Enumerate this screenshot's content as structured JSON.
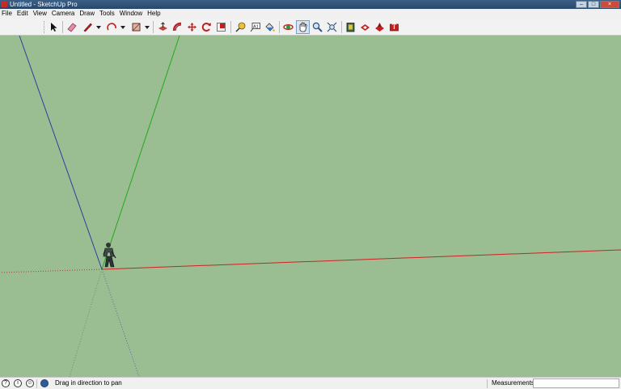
{
  "window": {
    "title": "Untitled - SketchUp Pro",
    "controls": [
      "minimize",
      "maximize",
      "close"
    ]
  },
  "menu": [
    "File",
    "Edit",
    "View",
    "Camera",
    "Draw",
    "Tools",
    "Window",
    "Help"
  ],
  "toolbar": {
    "tools": [
      {
        "name": "select-tool",
        "icon": "arrow-pointer-icon"
      },
      {
        "name": "eraser-tool",
        "icon": "eraser-icon"
      },
      {
        "name": "line-tool",
        "icon": "pencil-icon"
      },
      {
        "name": "arc-tool",
        "icon": "arc-icon"
      },
      {
        "name": "rectangle-tool",
        "icon": "rectangle-icon"
      },
      {
        "name": "push-pull-tool",
        "icon": "push-pull-icon"
      },
      {
        "name": "follow-me-tool",
        "icon": "follow-me-icon"
      },
      {
        "name": "move-tool",
        "icon": "move-arrows-icon"
      },
      {
        "name": "rotate-tool",
        "icon": "rotate-icon"
      },
      {
        "name": "scale-tool",
        "icon": "scale-icon"
      },
      {
        "name": "tape-measure-tool",
        "icon": "tape-measure-icon"
      },
      {
        "name": "text-tool",
        "icon": "text-a1-icon"
      },
      {
        "name": "paint-bucket-tool",
        "icon": "paint-bucket-icon"
      },
      {
        "name": "orbit-tool",
        "icon": "orbit-icon"
      },
      {
        "name": "pan-tool",
        "icon": "hand-icon",
        "active": true
      },
      {
        "name": "zoom-tool",
        "icon": "magnifier-icon"
      },
      {
        "name": "zoom-extents-tool",
        "icon": "zoom-extents-icon"
      },
      {
        "name": "warehouse-tool",
        "icon": "warehouse-icon"
      },
      {
        "name": "share-model-tool",
        "icon": "share-model-icon"
      },
      {
        "name": "extension-warehouse-tool",
        "icon": "extension-warehouse-icon"
      },
      {
        "name": "upload-tool",
        "icon": "upload-icon"
      }
    ]
  },
  "viewport": {
    "background": "#9bbd92",
    "axis_colors": {
      "red": "#cc2222",
      "green": "#22a822",
      "blue": "#2a3fa0"
    }
  },
  "status": {
    "message": "Drag in direction to pan",
    "measurements_label": "Measurements",
    "measurements_value": ""
  }
}
